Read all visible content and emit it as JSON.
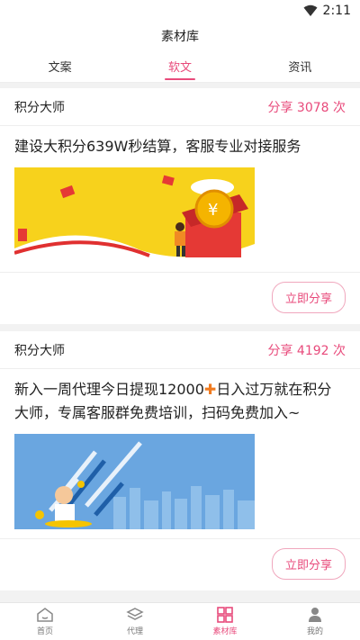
{
  "status_bar": {
    "time": "2:11"
  },
  "header": {
    "title": "素材库"
  },
  "tabs": [
    {
      "label": "文案",
      "active": false
    },
    {
      "label": "软文",
      "active": true
    },
    {
      "label": "资讯",
      "active": false
    }
  ],
  "cards": [
    {
      "author": "积分大师",
      "share_count": "分享 3078 次",
      "text": "建设大积分639W秒结算，客服专业对接服务",
      "share_button": "立即分享"
    },
    {
      "author": "积分大师",
      "share_count": "分享 4192 次",
      "text_before": "新入一周代理今日提现12000",
      "text_after": "日入过万就在积分大师，专属客服群免费培训，扫码免费加入~",
      "share_button": "立即分享"
    }
  ],
  "bottom_nav": [
    {
      "label": "首页",
      "icon": "home-icon",
      "active": false
    },
    {
      "label": "代理",
      "icon": "layers-icon",
      "active": false
    },
    {
      "label": "素材库",
      "icon": "grid-icon",
      "active": true
    },
    {
      "label": "我的",
      "icon": "user-icon",
      "active": false
    }
  ],
  "colors": {
    "accent": "#e84a7b"
  }
}
